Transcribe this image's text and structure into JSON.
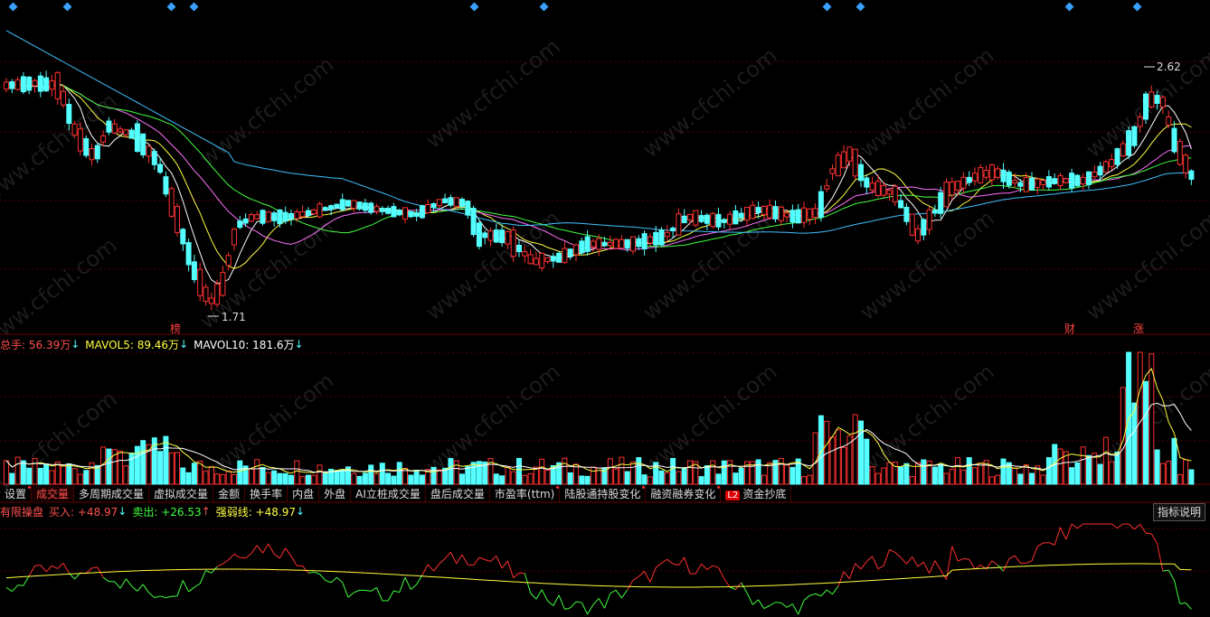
{
  "colors": {
    "up": "#ff3030",
    "down": "#54ffff",
    "ma5": "#ffffff",
    "ma10": "#ffff40",
    "ma20": "#ff70ff",
    "ma30": "#40ff40",
    "ma60": "#40c0ff",
    "grid": "#5a0000",
    "diamond": "#3aa0ff"
  },
  "price_panel": {
    "high_label": "2.62",
    "low_label": "1.71",
    "markers": [
      {
        "text": "榜"
      },
      {
        "text": "财"
      },
      {
        "text": "涨"
      }
    ]
  },
  "volume_header": {
    "total_label": "总手: 56.39万",
    "total_arrow": "↓",
    "ma5_label": "MAVOL5: 89.46万",
    "ma5_arrow": "↓",
    "ma10_label": "MAVOL10: 181.6万",
    "ma10_arrow": "↓"
  },
  "tabs": [
    {
      "label": "设置",
      "dot": true
    },
    {
      "label": "成交量",
      "active": true
    },
    {
      "label": "多周期成交量"
    },
    {
      "label": "虚拟成交量"
    },
    {
      "label": "金额"
    },
    {
      "label": "换手率"
    },
    {
      "label": "内盘"
    },
    {
      "label": "外盘"
    },
    {
      "label": "AI立桩成交量"
    },
    {
      "label": "盘后成交量"
    },
    {
      "label": "市盈率(ttm)",
      "dot": true
    },
    {
      "label": "陆股通持股变化",
      "dot": true
    },
    {
      "label": "融资融券变化",
      "dot": true
    },
    {
      "label": "资金抄底",
      "badge": "L2"
    }
  ],
  "indicator_header": {
    "name": "有限操盘",
    "buy_label": "买入: +48.97",
    "buy_arrow": "↓",
    "sell_label": "卖出: +26.53",
    "sell_arrow": "↑",
    "strong_label": "强弱线: +48.97",
    "strong_arrow": "↓",
    "help_button": "指标说明"
  },
  "watermark": "www.cfchi.com"
}
